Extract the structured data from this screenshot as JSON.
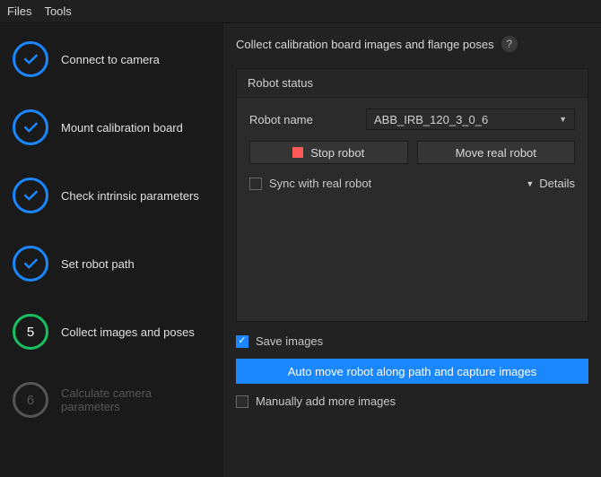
{
  "menu": {
    "files": "Files",
    "tools": "Tools"
  },
  "steps": [
    {
      "label": "Connect to camera",
      "state": "done"
    },
    {
      "label": "Mount calibration board",
      "state": "done"
    },
    {
      "label": "Check intrinsic parameters",
      "state": "done"
    },
    {
      "label": "Set robot path",
      "state": "done"
    },
    {
      "label": "Collect images and poses",
      "state": "current",
      "number": "5"
    },
    {
      "label": "Calculate camera parameters",
      "state": "disabled",
      "number": "6"
    }
  ],
  "header": {
    "title": "Collect calibration board images and flange poses",
    "help": "?"
  },
  "panel": {
    "title": "Robot status",
    "robot_name_label": "Robot name",
    "robot_name_value": "ABB_IRB_120_3_0_6",
    "stop_label": "Stop robot",
    "move_label": "Move real robot",
    "sync_label": "Sync with real robot",
    "sync_checked": false,
    "details_label": "Details"
  },
  "lower": {
    "save_images_label": "Save images",
    "save_images_checked": true,
    "auto_move_label": "Auto move robot along path and capture images",
    "manual_label": "Manually add more images",
    "manual_checked": false
  }
}
